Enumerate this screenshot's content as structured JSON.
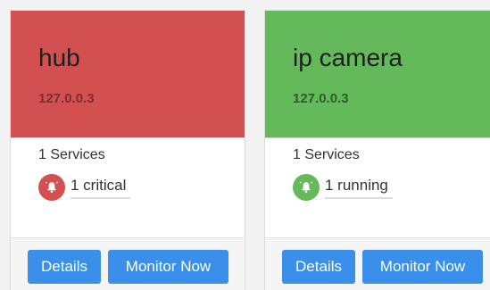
{
  "cards": [
    {
      "name": "hub",
      "ip": "127.0.0.3",
      "services": "1 Services",
      "status": "1 critical",
      "status_color": "#d2504f",
      "details_label": "Details",
      "monitor_label": "Monitor Now",
      "icon": "alarm-bell-icon"
    },
    {
      "name": "ip camera",
      "ip": "127.0.0.3",
      "services": "1 Services",
      "status": "1 running",
      "status_color": "#64b95b",
      "details_label": "Details",
      "monitor_label": "Monitor Now",
      "icon": "alarm-bell-icon"
    }
  ]
}
